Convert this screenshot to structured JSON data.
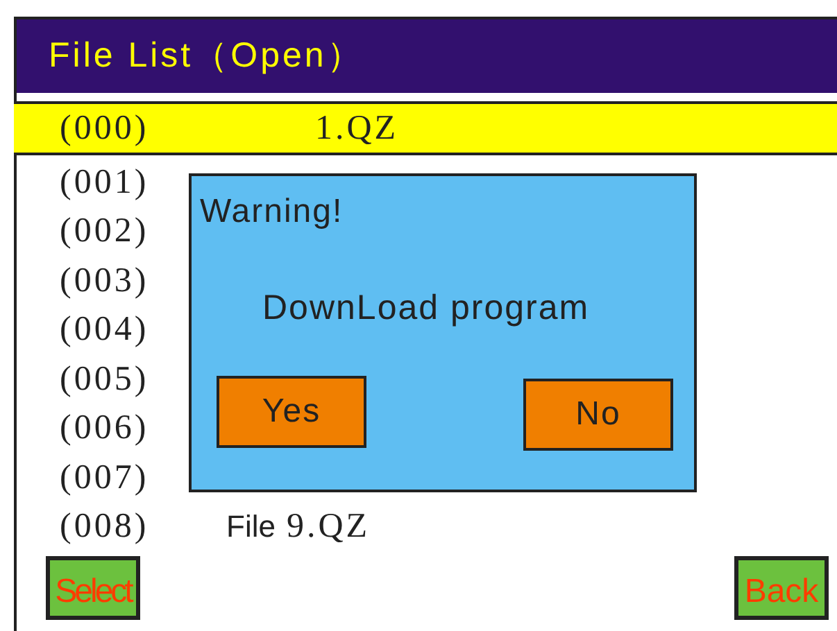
{
  "title": "File List（Open）",
  "rows": [
    {
      "number": "(000)",
      "name": "1.QZ",
      "selected": true
    },
    {
      "number": "(001)",
      "selected": false
    },
    {
      "number": "(002)",
      "selected": false
    },
    {
      "number": "(003)",
      "selected": false
    },
    {
      "number": "(004)",
      "selected": false
    },
    {
      "number": "(005)",
      "selected": false
    },
    {
      "number": "(006)",
      "selected": false
    },
    {
      "number": "(007)",
      "selected": false
    },
    {
      "number": "(008)",
      "prefix": "File",
      "name": "9.QZ",
      "selected": false
    }
  ],
  "dialog": {
    "title": "Warning!",
    "message": "DownLoad program",
    "buttons": [
      "Yes",
      "No"
    ]
  },
  "buttons": [
    "Select",
    "Back"
  ]
}
